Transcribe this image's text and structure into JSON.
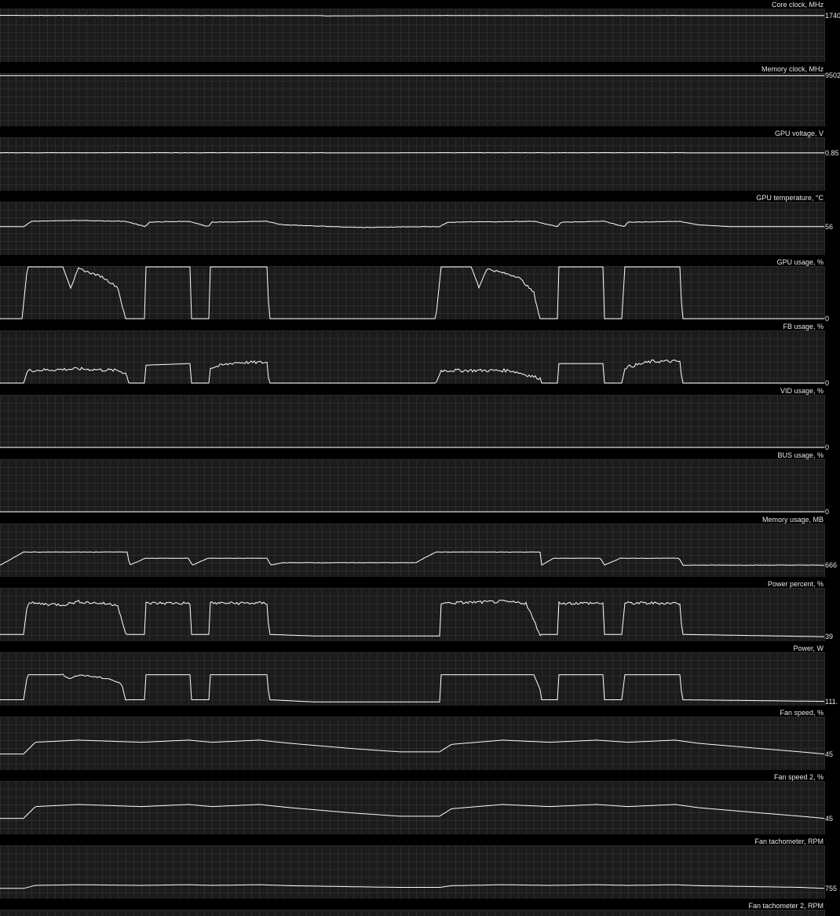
{
  "colors": {
    "background": "#000000",
    "plot_background": "#1b1b1b",
    "grid": "#2c2c2c",
    "line": "#ffffff",
    "text": "#e8e8e8"
  },
  "chart_data": [
    {
      "type": "line",
      "title": "Core clock, MHz",
      "current_value": "1740",
      "ylim": [
        0,
        2000
      ],
      "segments": [
        [
          0,
          1750
        ],
        [
          30,
          1748
        ],
        [
          410,
          1740
        ],
        [
          415,
          1730
        ],
        [
          560,
          1745
        ],
        [
          700,
          1742
        ],
        [
          870,
          1745
        ],
        [
          875,
          1740
        ],
        [
          1050,
          1740
        ]
      ],
      "noise": 4,
      "noise_ranges": [
        [
          30,
          410
        ],
        [
          560,
          870
        ]
      ]
    },
    {
      "type": "line",
      "title": "Memory clock, MHz",
      "current_value": "9502",
      "ylim": [
        0,
        10000
      ],
      "segments": [
        [
          0,
          9502
        ],
        [
          1050,
          9502
        ]
      ],
      "noise": 0,
      "noise_ranges": []
    },
    {
      "type": "line",
      "title": "GPU voltage, V",
      "current_value": "0.85",
      "ylim": [
        0,
        1.2
      ],
      "segments": [
        [
          0,
          0.855
        ],
        [
          410,
          0.855
        ],
        [
          415,
          0.85
        ],
        [
          560,
          0.855
        ],
        [
          870,
          0.855
        ],
        [
          875,
          0.85
        ],
        [
          1050,
          0.85
        ]
      ],
      "noise": 0.003,
      "noise_ranges": [
        [
          0,
          410
        ],
        [
          560,
          870
        ]
      ]
    },
    {
      "type": "line",
      "title": "GPU temperature, °C",
      "current_value": "56",
      "ylim": [
        40,
        70
      ],
      "segments": [
        [
          0,
          56
        ],
        [
          30,
          56
        ],
        [
          40,
          59
        ],
        [
          90,
          59.5
        ],
        [
          160,
          59
        ],
        [
          185,
          56
        ],
        [
          190,
          58.5
        ],
        [
          240,
          59
        ],
        [
          265,
          56
        ],
        [
          270,
          58.5
        ],
        [
          340,
          59
        ],
        [
          360,
          57
        ],
        [
          460,
          55.5
        ],
        [
          540,
          56
        ],
        [
          560,
          56
        ],
        [
          570,
          58.5
        ],
        [
          680,
          59
        ],
        [
          710,
          56
        ],
        [
          715,
          58.5
        ],
        [
          770,
          59
        ],
        [
          795,
          56
        ],
        [
          800,
          58.5
        ],
        [
          865,
          59
        ],
        [
          890,
          57
        ],
        [
          930,
          56
        ],
        [
          1050,
          56
        ]
      ],
      "noise": 0.15,
      "noise_ranges": [
        [
          30,
          870
        ]
      ]
    },
    {
      "type": "line",
      "title": "GPU usage, %",
      "current_value": "0",
      "ylim": [
        0,
        100
      ],
      "segments": [
        [
          0,
          0
        ],
        [
          28,
          0
        ],
        [
          35,
          100
        ],
        [
          80,
          100
        ],
        [
          90,
          60
        ],
        [
          100,
          95
        ],
        [
          130,
          80
        ],
        [
          150,
          60
        ],
        [
          160,
          0
        ],
        [
          184,
          0
        ],
        [
          186,
          100
        ],
        [
          242,
          100
        ],
        [
          244,
          0
        ],
        [
          266,
          0
        ],
        [
          268,
          100
        ],
        [
          340,
          100
        ],
        [
          343,
          0
        ],
        [
          555,
          0
        ],
        [
          562,
          100
        ],
        [
          600,
          100
        ],
        [
          610,
          60
        ],
        [
          620,
          95
        ],
        [
          660,
          80
        ],
        [
          680,
          50
        ],
        [
          688,
          0
        ],
        [
          710,
          0
        ],
        [
          712,
          100
        ],
        [
          768,
          100
        ],
        [
          770,
          0
        ],
        [
          793,
          0
        ],
        [
          795,
          100
        ],
        [
          866,
          100
        ],
        [
          869,
          0
        ],
        [
          1050,
          0
        ]
      ],
      "noise": 2,
      "noise_ranges": [
        [
          80,
          160
        ],
        [
          605,
          688
        ]
      ]
    },
    {
      "type": "line",
      "title": "FB usage, %",
      "current_value": "0",
      "ylim": [
        0,
        100
      ],
      "segments": [
        [
          0,
          0
        ],
        [
          30,
          0
        ],
        [
          35,
          25
        ],
        [
          100,
          28
        ],
        [
          150,
          25
        ],
        [
          160,
          20
        ],
        [
          165,
          0
        ],
        [
          184,
          0
        ],
        [
          186,
          35
        ],
        [
          242,
          38
        ],
        [
          244,
          0
        ],
        [
          266,
          0
        ],
        [
          268,
          30
        ],
        [
          300,
          40
        ],
        [
          340,
          40
        ],
        [
          343,
          0
        ],
        [
          555,
          0
        ],
        [
          562,
          25
        ],
        [
          650,
          25
        ],
        [
          688,
          10
        ],
        [
          690,
          0
        ],
        [
          710,
          0
        ],
        [
          712,
          38
        ],
        [
          768,
          38
        ],
        [
          770,
          0
        ],
        [
          793,
          0
        ],
        [
          795,
          30
        ],
        [
          830,
          42
        ],
        [
          866,
          42
        ],
        [
          869,
          0
        ],
        [
          1050,
          0
        ]
      ],
      "noise": 3,
      "noise_ranges": [
        [
          35,
          165
        ],
        [
          268,
          343
        ],
        [
          562,
          690
        ],
        [
          795,
          869
        ]
      ]
    },
    {
      "type": "line",
      "title": "VID usage, %",
      "current_value": "0",
      "ylim": [
        0,
        100
      ],
      "segments": [
        [
          0,
          0
        ],
        [
          1050,
          0
        ]
      ],
      "noise": 0,
      "noise_ranges": []
    },
    {
      "type": "line",
      "title": "BUS usage, %",
      "current_value": "0",
      "ylim": [
        0,
        100
      ],
      "segments": [
        [
          0,
          1
        ],
        [
          1050,
          1
        ]
      ],
      "noise": 0.5,
      "noise_ranges": [
        [
          0,
          1050
        ]
      ]
    },
    {
      "type": "line",
      "title": "Memory usage, MB",
      "current_value": "666",
      "ylim": [
        600,
        900
      ],
      "segments": [
        [
          0,
          666
        ],
        [
          10,
          690
        ],
        [
          30,
          740
        ],
        [
          162,
          740
        ],
        [
          165,
          666
        ],
        [
          185,
          705
        ],
        [
          240,
          705
        ],
        [
          245,
          666
        ],
        [
          265,
          705
        ],
        [
          340,
          705
        ],
        [
          345,
          666
        ],
        [
          360,
          680
        ],
        [
          530,
          680
        ],
        [
          540,
          705
        ],
        [
          555,
          740
        ],
        [
          688,
          740
        ],
        [
          690,
          666
        ],
        [
          705,
          705
        ],
        [
          765,
          705
        ],
        [
          770,
          666
        ],
        [
          790,
          705
        ],
        [
          865,
          705
        ],
        [
          870,
          666
        ],
        [
          1050,
          666
        ]
      ],
      "noise": 1,
      "noise_ranges": [
        [
          0,
          1050
        ]
      ]
    },
    {
      "type": "line",
      "title": "Power percent, %",
      "current_value": "39",
      "ylim": [
        30,
        100
      ],
      "segments": [
        [
          0,
          39
        ],
        [
          30,
          39
        ],
        [
          35,
          80
        ],
        [
          80,
          78
        ],
        [
          100,
          82
        ],
        [
          150,
          78
        ],
        [
          160,
          39
        ],
        [
          184,
          39
        ],
        [
          186,
          80
        ],
        [
          242,
          80
        ],
        [
          244,
          39
        ],
        [
          266,
          39
        ],
        [
          268,
          80
        ],
        [
          340,
          80
        ],
        [
          343,
          39
        ],
        [
          400,
          37
        ],
        [
          560,
          37
        ],
        [
          562,
          80
        ],
        [
          640,
          82
        ],
        [
          670,
          80
        ],
        [
          688,
          39
        ],
        [
          710,
          39
        ],
        [
          712,
          80
        ],
        [
          768,
          80
        ],
        [
          770,
          39
        ],
        [
          793,
          39
        ],
        [
          795,
          80
        ],
        [
          866,
          80
        ],
        [
          869,
          39
        ],
        [
          1050,
          36
        ]
      ],
      "noise": 2,
      "noise_ranges": [
        [
          35,
          160
        ],
        [
          186,
          242
        ],
        [
          268,
          340
        ],
        [
          562,
          688
        ],
        [
          712,
          768
        ],
        [
          795,
          866
        ]
      ]
    },
    {
      "type": "line",
      "title": "Power, W",
      "current_value": "111.",
      "ylim": [
        100,
        200
      ],
      "segments": [
        [
          0,
          111
        ],
        [
          30,
          111
        ],
        [
          35,
          158
        ],
        [
          80,
          158
        ],
        [
          90,
          150
        ],
        [
          100,
          158
        ],
        [
          140,
          150
        ],
        [
          155,
          140
        ],
        [
          160,
          111
        ],
        [
          184,
          111
        ],
        [
          186,
          158
        ],
        [
          242,
          158
        ],
        [
          244,
          111
        ],
        [
          266,
          111
        ],
        [
          268,
          158
        ],
        [
          340,
          158
        ],
        [
          343,
          111
        ],
        [
          400,
          107
        ],
        [
          560,
          107
        ],
        [
          562,
          158
        ],
        [
          680,
          158
        ],
        [
          688,
          130
        ],
        [
          690,
          111
        ],
        [
          710,
          111
        ],
        [
          712,
          158
        ],
        [
          768,
          158
        ],
        [
          770,
          111
        ],
        [
          793,
          111
        ],
        [
          795,
          158
        ],
        [
          866,
          158
        ],
        [
          869,
          111
        ],
        [
          1050,
          108
        ]
      ],
      "noise": 1.5,
      "noise_ranges": [
        [
          80,
          160
        ]
      ]
    },
    {
      "type": "line",
      "title": "Fan speed, %",
      "current_value": "45",
      "ylim": [
        30,
        80
      ],
      "segments": [
        [
          0,
          45
        ],
        [
          30,
          45
        ],
        [
          45,
          56
        ],
        [
          100,
          58
        ],
        [
          180,
          56
        ],
        [
          240,
          58
        ],
        [
          270,
          56
        ],
        [
          330,
          58
        ],
        [
          370,
          55
        ],
        [
          450,
          50
        ],
        [
          510,
          47
        ],
        [
          560,
          47
        ],
        [
          575,
          54
        ],
        [
          640,
          58
        ],
        [
          700,
          56
        ],
        [
          760,
          58
        ],
        [
          800,
          56
        ],
        [
          860,
          58
        ],
        [
          890,
          55
        ],
        [
          970,
          50
        ],
        [
          1020,
          47
        ],
        [
          1050,
          45
        ]
      ],
      "noise": 0,
      "noise_ranges": []
    },
    {
      "type": "line",
      "title": "Fan speed 2, %",
      "current_value": "45",
      "ylim": [
        30,
        80
      ],
      "segments": [
        [
          0,
          45
        ],
        [
          30,
          45
        ],
        [
          45,
          56
        ],
        [
          100,
          58
        ],
        [
          180,
          56
        ],
        [
          240,
          58
        ],
        [
          270,
          56
        ],
        [
          330,
          58
        ],
        [
          370,
          55
        ],
        [
          450,
          50
        ],
        [
          510,
          47
        ],
        [
          560,
          47
        ],
        [
          575,
          54
        ],
        [
          640,
          58
        ],
        [
          700,
          56
        ],
        [
          760,
          58
        ],
        [
          800,
          56
        ],
        [
          860,
          58
        ],
        [
          890,
          55
        ],
        [
          970,
          50
        ],
        [
          1020,
          47
        ],
        [
          1050,
          45
        ]
      ],
      "noise": 0,
      "noise_ranges": []
    },
    {
      "type": "line",
      "title": "Fan tachometer, RPM",
      "current_value": "755",
      "ylim": [
        600,
        1400
      ],
      "segments": [
        [
          0,
          755
        ],
        [
          30,
          755
        ],
        [
          45,
          800
        ],
        [
          100,
          810
        ],
        [
          180,
          800
        ],
        [
          240,
          810
        ],
        [
          270,
          800
        ],
        [
          330,
          810
        ],
        [
          370,
          795
        ],
        [
          450,
          780
        ],
        [
          510,
          770
        ],
        [
          560,
          770
        ],
        [
          575,
          795
        ],
        [
          640,
          810
        ],
        [
          700,
          800
        ],
        [
          760,
          810
        ],
        [
          800,
          800
        ],
        [
          860,
          810
        ],
        [
          890,
          795
        ],
        [
          970,
          780
        ],
        [
          1020,
          770
        ],
        [
          1050,
          755
        ]
      ],
      "noise": 0,
      "noise_ranges": []
    },
    {
      "type": "line",
      "title": "Fan tachometer 2, RPM",
      "current_value": "",
      "ylim": [
        0,
        100
      ],
      "segments": [],
      "noise": 0,
      "noise_ranges": []
    }
  ]
}
